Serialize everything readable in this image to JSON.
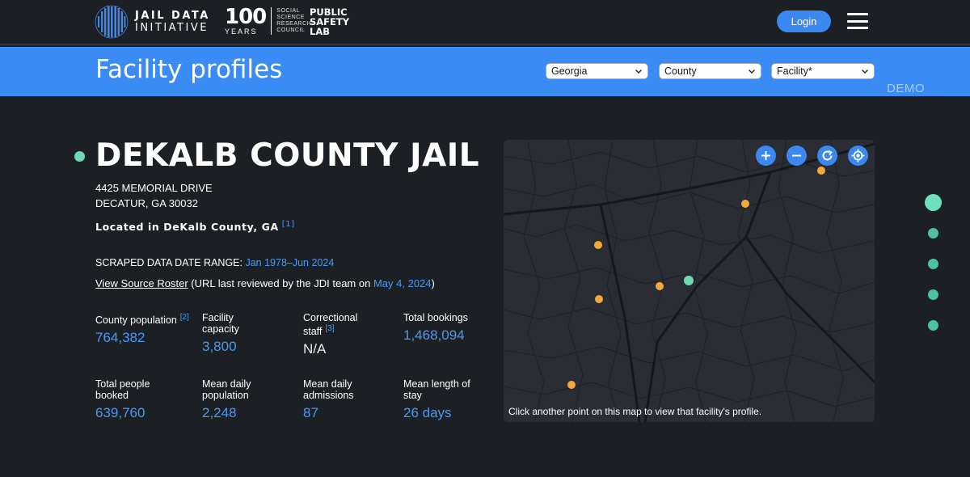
{
  "header": {
    "logo_jdi": {
      "line1": "JAIL DATA",
      "line2": "INITIATIVE"
    },
    "logo_100": {
      "number": "100",
      "years": "YEARS",
      "org_lines": [
        "SOCIAL",
        "SCIENCE",
        "RESEARCH",
        "COUNCIL"
      ]
    },
    "logo_psl": {
      "lines": [
        "PUBLIC",
        "SAFETY",
        "LAB"
      ]
    },
    "login_label": "Login"
  },
  "band": {
    "title": "Facility profiles",
    "selects": {
      "state": "Georgia",
      "county": "County",
      "facility": "Facility*"
    },
    "demo": "DEMO"
  },
  "facility": {
    "name": "DEKALB COUNTY JAIL",
    "address_line1": "4425 MEMORIAL DRIVE",
    "address_line2": "DECATUR, GA 30032",
    "located": "Located in DeKalb County, GA",
    "located_ref": "[1]",
    "scraped_label": "SCRAPED DATA DATE RANGE:",
    "scraped_range": "Jan 1978–Jun 2024",
    "roster_link": "View Source Roster",
    "roster_note_pre": "(URL last reviewed by the JDI team on",
    "roster_date": "May 4, 2024",
    "roster_note_post": ")"
  },
  "stats": [
    {
      "label": "County population",
      "ref": "[2]",
      "value": "764,382"
    },
    {
      "label": "Facility capacity",
      "ref": "",
      "value": "3,800"
    },
    {
      "label": "Correctional staff",
      "ref": "[3]",
      "value": "N/A"
    },
    {
      "label": "Total bookings",
      "ref": "",
      "value": "1,468,094"
    },
    {
      "label": "Total people booked",
      "ref": "",
      "value": "639,760"
    },
    {
      "label": "Mean daily population",
      "ref": "",
      "value": "2,248"
    },
    {
      "label": "Mean daily admissions",
      "ref": "",
      "value": "87"
    },
    {
      "label": "Mean length of stay",
      "ref": "",
      "value": "26 days"
    }
  ],
  "map": {
    "caption": "Click another point on this map to view that facility's profile.",
    "controls": [
      "plus-icon",
      "minus-icon",
      "refresh-icon",
      "locate-icon"
    ],
    "colors": {
      "facility_point": "#f5a93a",
      "selected_point": "#6fd8b4"
    }
  },
  "section_nav": {
    "count": 5,
    "active_index": 0
  }
}
